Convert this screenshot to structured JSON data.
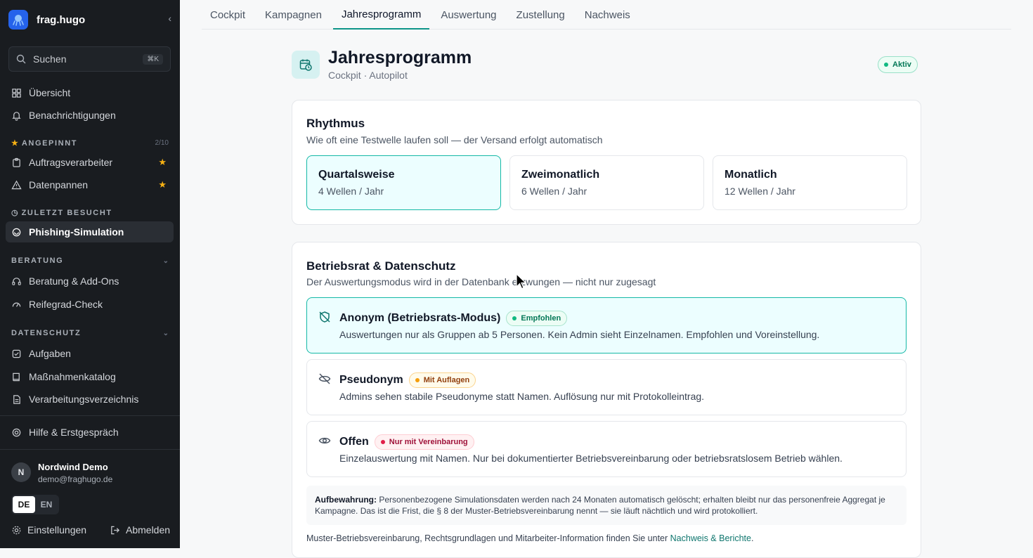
{
  "app": {
    "name": "frag.hugo"
  },
  "search": {
    "placeholder": "Suchen",
    "shortcut": "⌘K"
  },
  "nav": {
    "overview": "Übersicht",
    "notifications": "Benachrichtigungen"
  },
  "pinned": {
    "title": "ANGEPINNT",
    "count": "2/10",
    "items": [
      {
        "label": "Auftragsverarbeiter"
      },
      {
        "label": "Datenpannen"
      }
    ]
  },
  "recent": {
    "title": "ZULETZT BESUCHT",
    "items": [
      {
        "label": "Phishing-Simulation"
      }
    ]
  },
  "beratung": {
    "title": "BERATUNG",
    "items": [
      {
        "label": "Beratung & Add-Ons"
      },
      {
        "label": "Reifegrad-Check"
      }
    ]
  },
  "datenschutz": {
    "title": "DATENSCHUTZ",
    "items": [
      {
        "label": "Aufgaben"
      },
      {
        "label": "Maßnahmenkatalog"
      },
      {
        "label": "Verarbeitungsverzeichnis"
      }
    ]
  },
  "help": {
    "label": "Hilfe & Erstgespräch"
  },
  "user": {
    "initial": "N",
    "name": "Nordwind Demo",
    "email": "demo@fraghugo.de"
  },
  "languages": [
    "DE",
    "EN"
  ],
  "footer_nav": {
    "settings": "Einstellungen",
    "logout": "Abmelden"
  },
  "tabs": [
    "Cockpit",
    "Kampagnen",
    "Jahresprogramm",
    "Auswertung",
    "Zustellung",
    "Nachweis"
  ],
  "header": {
    "title": "Jahresprogramm",
    "subtitle": "Cockpit · Autopilot",
    "status": "Aktiv"
  },
  "rhythm": {
    "title": "Rhythmus",
    "subtitle": "Wie oft eine Testwelle laufen soll — der Versand erfolgt automatisch",
    "options": [
      {
        "title": "Quartalsweise",
        "detail": "4 Wellen / Jahr"
      },
      {
        "title": "Zweimonatlich",
        "detail": "6 Wellen / Jahr"
      },
      {
        "title": "Monatlich",
        "detail": "12 Wellen / Jahr"
      }
    ]
  },
  "privacy": {
    "title": "Betriebsrat & Datenschutz",
    "subtitle": "Der Auswertungsmodus wird in der Datenbank erzwungen — nicht nur zugesagt",
    "modes": [
      {
        "name": "Anonym (Betriebsrats-Modus)",
        "badge": "Empfohlen",
        "desc": "Auswertungen nur als Gruppen ab 5 Personen. Kein Admin sieht Einzelnamen. Empfohlen und Voreinstellung."
      },
      {
        "name": "Pseudonym",
        "badge": "Mit Auflagen",
        "desc": "Admins sehen stabile Pseudonyme statt Namen. Auflösung nur mit Protokolleintrag."
      },
      {
        "name": "Offen",
        "badge": "Nur mit Vereinbarung",
        "desc": "Einzelauswertung mit Namen. Nur bei dokumentierter Betriebsvereinbarung oder betriebsratslosem Betrieb wählen."
      }
    ],
    "retention_label": "Aufbewahrung:",
    "retention_text": "Personenbezogene Simulationsdaten werden nach 24 Monaten automatisch gelöscht; erhalten bleibt nur das personenfreie Aggregat je Kampagne. Das ist die Frist, die § 8 der Muster-Betriebsvereinbarung nennt — sie läuft nächtlich und wird protokolliert.",
    "footer_text": "Muster-Betriebsvereinbarung, Rechtsgrundlagen und Mitarbeiter-Information finden Sie unter ",
    "footer_link": "Nachweis & Berichte",
    "footer_end": "."
  },
  "colors": {
    "accent": "#0d9488",
    "sidebar_bg": "#191c20",
    "star": "#f5b014"
  }
}
